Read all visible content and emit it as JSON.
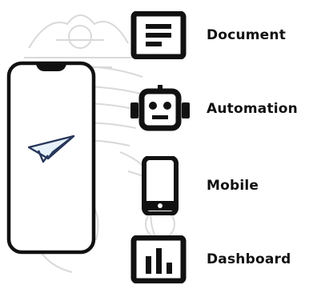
{
  "features": [
    {
      "icon": "document-icon",
      "label": "Document"
    },
    {
      "icon": "robot-icon",
      "label": "Automation"
    },
    {
      "icon": "smartphone-icon",
      "label": "Mobile"
    },
    {
      "icon": "bar-chart-icon",
      "label": "Dashboard"
    }
  ],
  "colors": {
    "outline": "#111111",
    "plane_fill": "#e4f0f8",
    "plane_stroke": "#2a3b5c",
    "watermark": "#d6d6d6"
  }
}
